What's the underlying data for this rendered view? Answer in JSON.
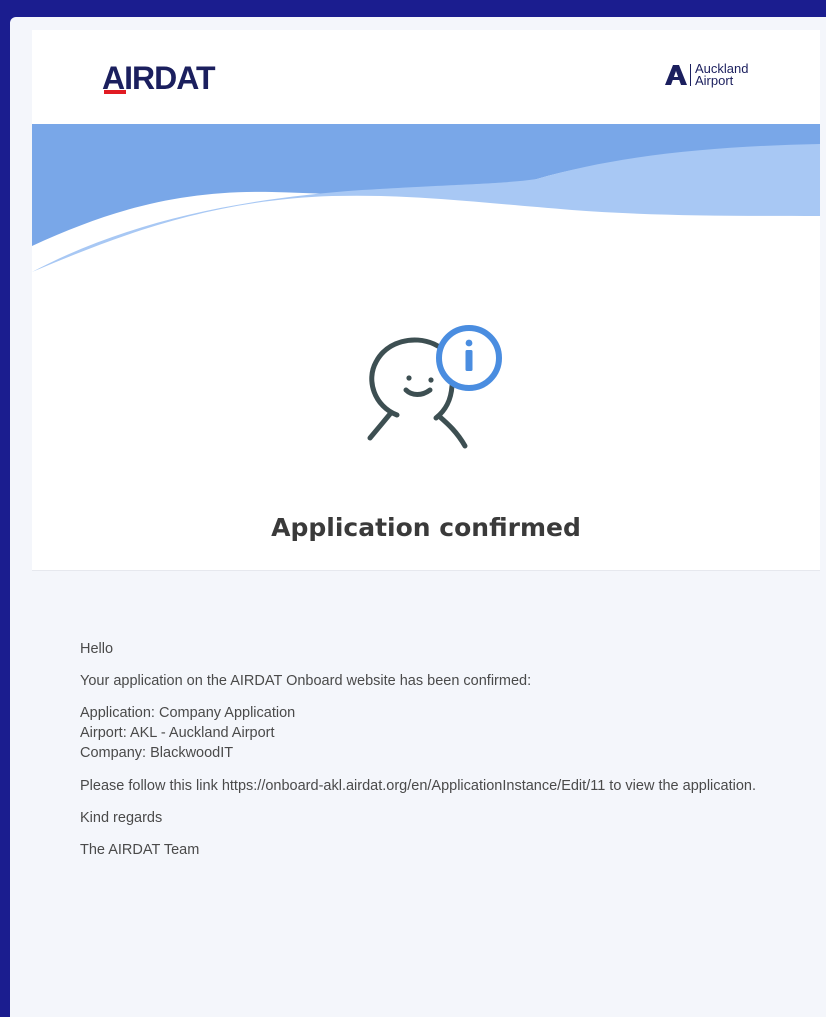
{
  "header": {
    "brand": "AIRDAT",
    "partner_line1": "Auckland",
    "partner_line2": "Airport"
  },
  "colors": {
    "page_background": "#1b1d8f",
    "wave_dark": "#79a7e8",
    "wave_light": "#a8c8f4",
    "info_badge": "#4a8de0",
    "figure": "#3d4f52",
    "brand_navy": "#1b1f5e",
    "brand_red": "#e11b22"
  },
  "illustration": {
    "character_icon": "smiling-person-icon",
    "badge_icon": "info-icon",
    "badge_glyph": "i"
  },
  "title": "Application confirmed",
  "email": {
    "greeting": "Hello",
    "intro": "Your application on the AIRDAT Onboard website has been confirmed:",
    "application_line": "Application: Company Application",
    "airport_line": "Airport: AKL - Auckland Airport",
    "company_line": "Company: BlackwoodIT",
    "link_sentence_prefix": "Please follow this link ",
    "link_url": "https://onboard-akl.airdat.org/en/ApplicationInstance/Edit/11",
    "link_sentence_suffix": " to view the application.",
    "closing": "Kind regards",
    "signature": "The AIRDAT Team"
  }
}
